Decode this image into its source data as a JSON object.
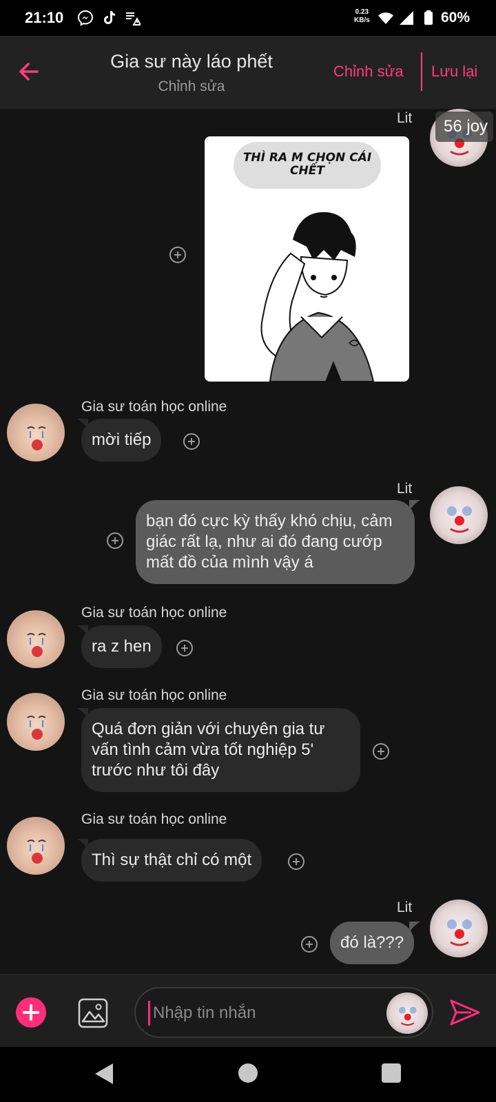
{
  "status_bar": {
    "time": "21:10",
    "net_speed_value": "0.23",
    "net_speed_unit": "KB/s",
    "battery": "60%",
    "icons": [
      "messenger-icon",
      "tiktok-icon",
      "data-saver-icon",
      "wifi-icon",
      "signal-icon",
      "battery-icon"
    ]
  },
  "header": {
    "title": "Gia sư này láo phết",
    "subtitle": "Chỉnh sửa",
    "edit_label": "Chỉnh sửa",
    "save_label": "Lưu lại",
    "accent": "#ff3d7f"
  },
  "chat": {
    "image_message": {
      "sender": "Lit",
      "caption": "THÌ RA M CHỌN CÁI CHẾT",
      "badge": "56 joy"
    },
    "messages": [
      {
        "sender": "Gia sư toán học online",
        "text": "mời tiếp",
        "direction": "in"
      },
      {
        "sender": "Lit",
        "text": "bạn đó cực kỳ thấy khó chịu, cảm giác rất lạ, như ai đó đang cướp mất đồ của mình vậy á",
        "direction": "out"
      },
      {
        "sender": "Gia sư toán học online",
        "text": "ra z hen",
        "direction": "in"
      },
      {
        "sender": "Gia sư toán học online",
        "text": "Quá đơn giản với chuyên gia tư vấn tình cảm vừa tốt nghiệp 5' trước như tôi đây",
        "direction": "in"
      },
      {
        "sender": "Gia sư toán học online",
        "text": "Thì sự thật chỉ có một",
        "direction": "in"
      },
      {
        "sender": "Lit",
        "text": "đó là???",
        "direction": "out"
      }
    ]
  },
  "input": {
    "placeholder": "Nhập tin nhắn"
  }
}
